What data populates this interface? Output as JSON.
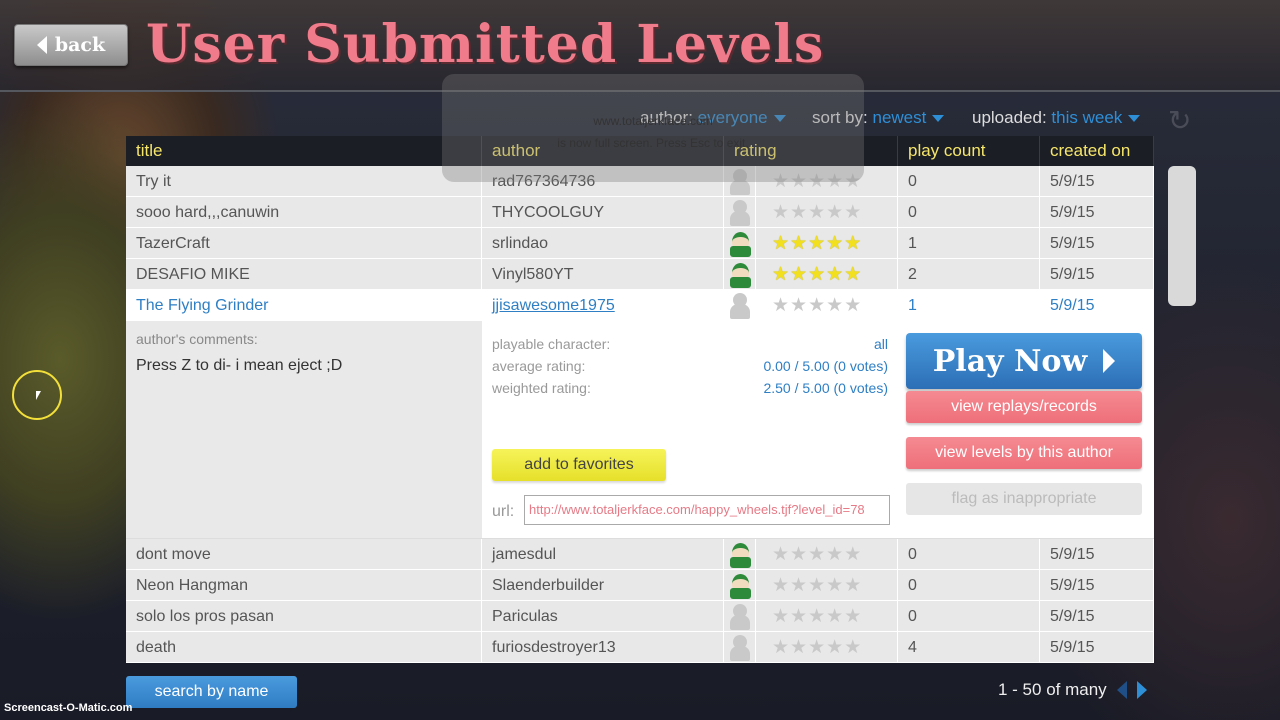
{
  "header": {
    "back_label": "back",
    "title": "User Submitted Levels"
  },
  "fullscreen_notice": {
    "line1": "www.totaljerkface.com",
    "line2": "is now full screen. Press Esc to exit."
  },
  "filters": {
    "author_label": "author:",
    "author_value": "everyone",
    "sort_label": "sort by:",
    "sort_value": "newest",
    "uploaded_label": "uploaded:",
    "uploaded_value": "this week"
  },
  "columns": {
    "title": "title",
    "author": "author",
    "rating": "rating",
    "play_count": "play count",
    "created_on": "created on"
  },
  "rows_top": [
    {
      "title": "Try it",
      "author": "rad767364736",
      "avatar": "none",
      "stars": 0,
      "plays": "0",
      "created": "5/9/15"
    },
    {
      "title": "sooo hard,,,canuwin",
      "author": "THYCOOLGUY",
      "avatar": "none",
      "stars": 0,
      "plays": "0",
      "created": "5/9/15"
    },
    {
      "title": "TazerCraft",
      "author": "srlindao",
      "avatar": "char",
      "stars": 5,
      "plays": "1",
      "created": "5/9/15"
    },
    {
      "title": "DESAFIO MIKE",
      "author": "Vinyl580YT",
      "avatar": "char",
      "stars": 5,
      "plays": "2",
      "created": "5/9/15"
    },
    {
      "title": "The Flying Grinder",
      "author": "jjisawesome1975",
      "avatar": "none",
      "stars": 0,
      "plays": "1",
      "created": "5/9/15"
    }
  ],
  "detail": {
    "comments_label": "author's comments:",
    "comment": "Press Z to di- i mean eject ;D",
    "playable_label": "playable character:",
    "playable_value": "all",
    "avg_label": "average rating:",
    "avg_value": "0.00 / 5.00 (0 votes)",
    "weighted_label": "weighted rating:",
    "weighted_value": "2.50 / 5.00 (0 votes)",
    "favorites_label": "add to favorites",
    "url_label": "url:",
    "url_value": "http://www.totaljerkface.com/happy_wheels.tjf?level_id=78",
    "play_now_label": "Play Now",
    "replays_label": "view replays/records",
    "by_author_label": "view levels by this author",
    "flag_label": "flag as inappropriate"
  },
  "rows_bottom": [
    {
      "title": "dont move",
      "author": "jamesdul",
      "avatar": "char",
      "stars": 0,
      "plays": "0",
      "created": "5/9/15"
    },
    {
      "title": "Neon Hangman",
      "author": "Slaenderbuilder",
      "avatar": "char",
      "stars": 0,
      "plays": "0",
      "created": "5/9/15"
    },
    {
      "title": "solo los pros pasan",
      "author": "Pariculas",
      "avatar": "none",
      "stars": 0,
      "plays": "0",
      "created": "5/9/15"
    },
    {
      "title": "death",
      "author": "furiosdestroyer13",
      "avatar": "none",
      "stars": 0,
      "plays": "4",
      "created": "5/9/15"
    }
  ],
  "footer": {
    "search_label": "search by name",
    "pager_text": "1 - 50 of many"
  },
  "watermark": "Screencast-O-Matic.com",
  "colors": {
    "title_pink": "#f07b8a",
    "link_blue": "#2e7fc4",
    "header_yellow": "#f6e66a",
    "star_on": "#f2e01e",
    "star_off": "#c9c9c9"
  }
}
